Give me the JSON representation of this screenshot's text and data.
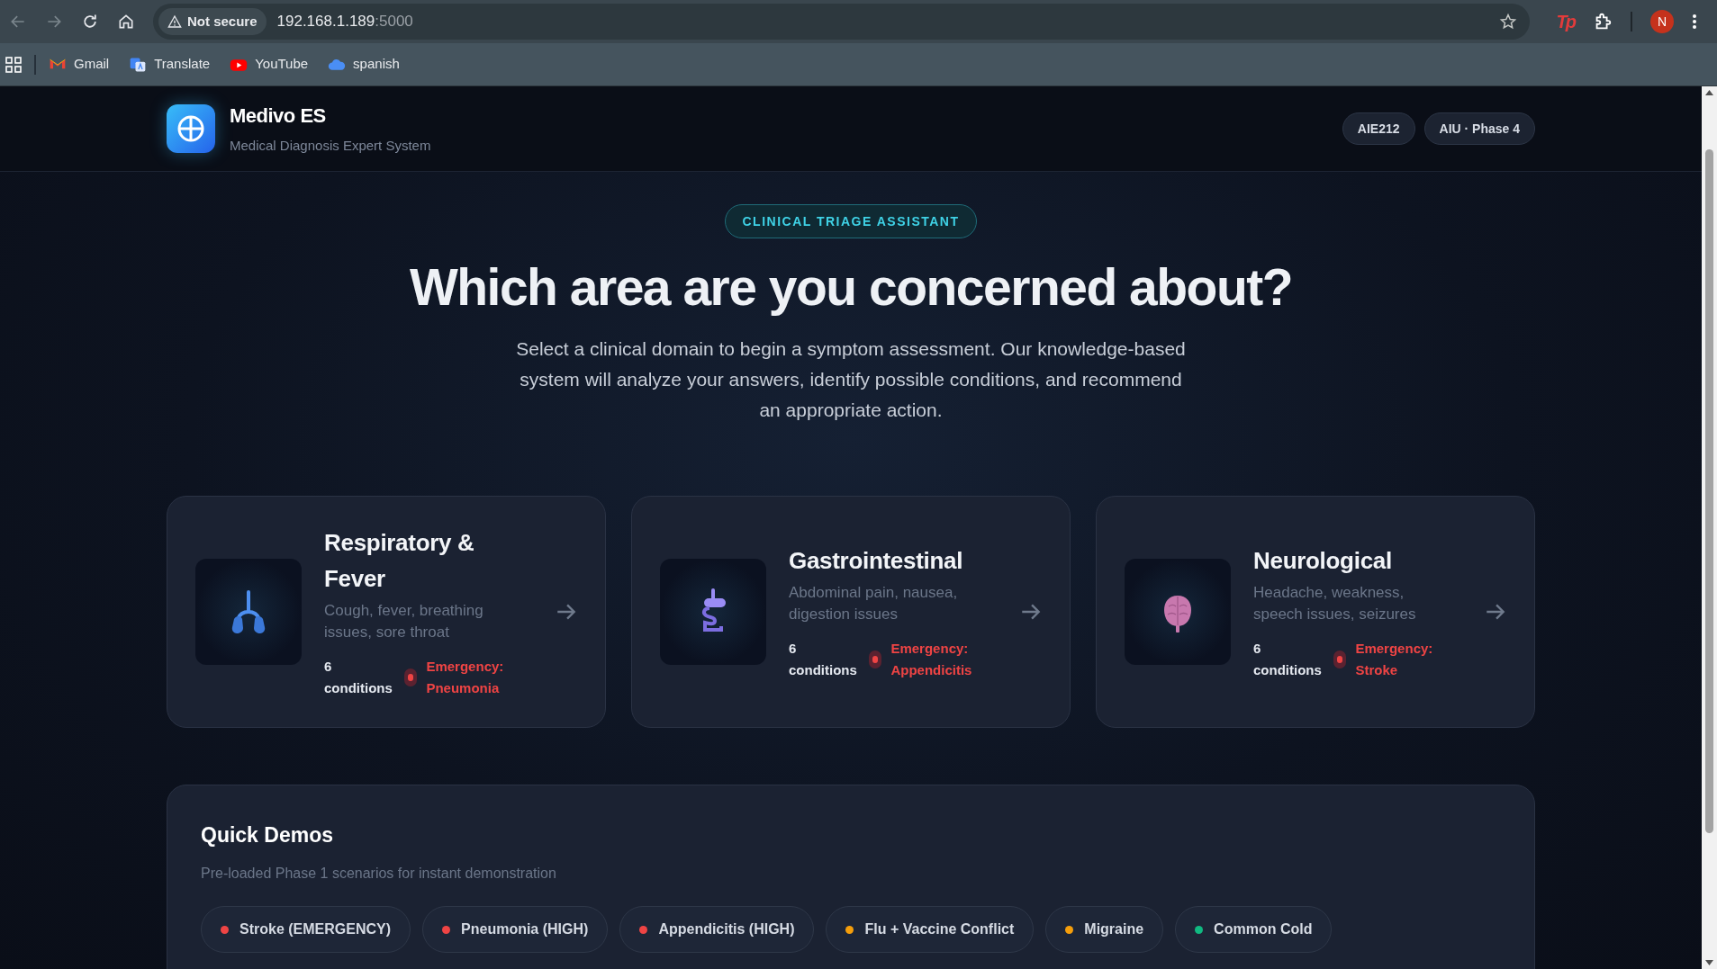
{
  "browser": {
    "security": "Not secure",
    "host": "192.168.1.189",
    "port": ":5000",
    "extension_label": "Tp",
    "profile_initial": "N",
    "bookmarks": [
      {
        "kind": "gmail",
        "label": "Gmail"
      },
      {
        "kind": "translate",
        "label": "Translate"
      },
      {
        "kind": "youtube",
        "label": "YouTube"
      },
      {
        "kind": "cloud",
        "label": "spanish"
      }
    ]
  },
  "header": {
    "title": "Medivo ES",
    "subtitle": "Medical Diagnosis Expert System",
    "badges": [
      "AIE212",
      "AIU · Phase 4"
    ]
  },
  "hero": {
    "eyebrow": "CLINICAL TRIAGE ASSISTANT",
    "heading": "Which area are you concerned about?",
    "description": "Select a clinical domain to begin a symptom assessment. Our knowledge-based system will analyze your answers, identify possible conditions, and recommend an appropriate action."
  },
  "domains": [
    {
      "kind": "lungs",
      "title": "Respiratory & Fever",
      "description": "Cough, fever, breathing issues, sore throat",
      "count": "6 conditions",
      "emergency": "Emergency: Pneumonia"
    },
    {
      "kind": "gut",
      "title": "Gastrointestinal",
      "description": "Abdominal pain, nausea, digestion issues",
      "count": "6 conditions",
      "emergency": "Emergency: Appendicitis"
    },
    {
      "kind": "brain",
      "title": "Neurological",
      "description": "Headache, weakness, speech issues, seizures",
      "count": "6 conditions",
      "emergency": "Emergency: Stroke"
    }
  ],
  "quick_demos": {
    "title": "Quick Demos",
    "subtitle": "Pre-loaded Phase 1 scenarios for instant demonstration",
    "items": [
      {
        "label": "Stroke (EMERGENCY)",
        "color": "#ef4444"
      },
      {
        "label": "Pneumonia (HIGH)",
        "color": "#ef4444"
      },
      {
        "label": "Appendicitis (HIGH)",
        "color": "#ef4444"
      },
      {
        "label": "Flu + Vaccine Conflict",
        "color": "#f59e0b"
      },
      {
        "label": "Migraine",
        "color": "#f59e0b"
      },
      {
        "label": "Common Cold",
        "color": "#10b981"
      }
    ]
  }
}
